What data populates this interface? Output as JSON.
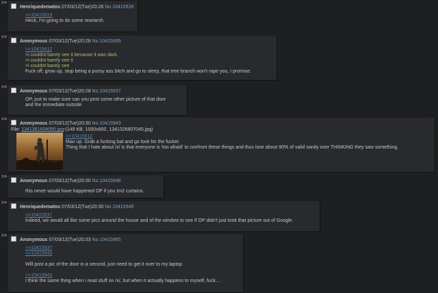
{
  "arrow_glyph": ">>",
  "posts": [
    {
      "name": "Henriquedematos",
      "date": "07/03/12(Tue)20:26",
      "no": "No.10415928",
      "quote": ">>10415919",
      "text": "Heck, I'm going to do some research."
    },
    {
      "name": "Anonymous",
      "date": "07/03/12(Tue)20:28",
      "no": "No.10415935",
      "quote": ">>10415612",
      "greentext": [
        ">i couldnt barely see it because it was dark.",
        ">i couldnt barely see it",
        ">i couldnt barely see"
      ],
      "text": "Fuck off, grow up, stop being a pussy ass bitch and go to sleep, that tree branch won't rape you, I promise."
    },
    {
      "name": "Anonymous",
      "date": "07/03/12(Tue)20:28",
      "no": "No.10415937",
      "lines": [
        "OP, just to make sure can you post some other picture of that door",
        "and the immediate outside"
      ]
    },
    {
      "name": "Anonymous",
      "date": "07/03/12(Tue)20:30",
      "no": "No.10415943",
      "file_label": "File:",
      "file_name": "1341361834050.jpg",
      "file_meta": "-(149 KB, 1000x800, 1341326807045.jpg)",
      "quote": ">>10415612",
      "lines": [
        "Man up. Grab a fucking bat and go look for the fucker.",
        "Thing that I hate about /x/ is that everyone is 'too afraid' to confront these things and thus lose about 90% of valid sanity over THINKING they saw something."
      ]
    },
    {
      "name": "Anonymous",
      "date": "07/03/12(Tue)20:30",
      "no": "No.10415948",
      "text": "this never would have happened OP if you Im2 curtains."
    },
    {
      "name": "Henriquedematos",
      "date": "07/03/12(Tue)20:30",
      "no": "No.10415949",
      "quote": ">>10415937",
      "text": "Indeed, we would all like some pics around the house and of the window to see if OP didn't just took that picture out of Google."
    },
    {
      "name": "Anonymous",
      "date": "07/03/12(Tue)20:33",
      "no": "No.10415965",
      "quotes_top": [
        ">>10415937",
        ">>10415949"
      ],
      "text_mid": "Will post a pic of the door in a second, just need to get it over to my laptop",
      "quote_bottom": ">>10415943",
      "text_bottom": "I think the same thing when i read stuff on /x/, but when it actually happens to myself, fuck...."
    }
  ]
}
